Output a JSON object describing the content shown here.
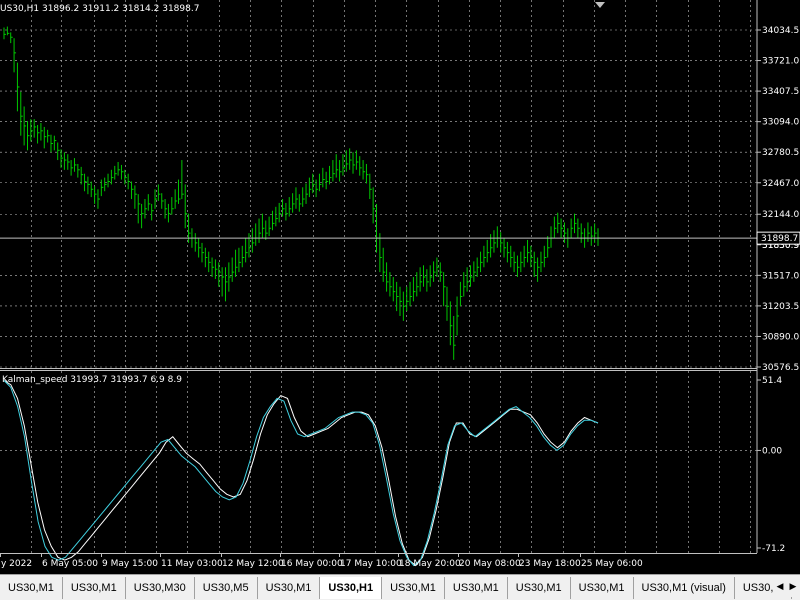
{
  "main_chart": {
    "symbol_label": "US30,H1",
    "ohlc_text": "31896.2 31911.2 31814.2 31898.7",
    "current_price_label": "31898.7",
    "hidden_price_label": "31830.9",
    "price_ticks": [
      "34034.5",
      "33721.0",
      "33407.5",
      "33094.0",
      "32780.5",
      "32467.0",
      "32144.0",
      "31830.5",
      "31517.0",
      "31203.5",
      "30890.0",
      "30576.5"
    ],
    "up_color": "#00c800",
    "grid_color": "#c0c0c0",
    "series_bars": [
      [
        33990,
        34060,
        33940
      ],
      [
        34000,
        34070,
        33980
      ],
      [
        33960,
        34010,
        33900
      ],
      [
        33800,
        33950,
        33600
      ],
      [
        33450,
        33700,
        33200
      ],
      [
        33150,
        33400,
        32950
      ],
      [
        33050,
        33250,
        32850
      ],
      [
        32950,
        33100,
        32800
      ],
      [
        33000,
        33120,
        32890
      ],
      [
        33040,
        33120,
        32930
      ],
      [
        32980,
        33060,
        32870
      ],
      [
        33000,
        33080,
        32900
      ],
      [
        32940,
        33040,
        32820
      ],
      [
        32950,
        33010,
        32880
      ],
      [
        32870,
        32960,
        32780
      ],
      [
        32900,
        32950,
        32800
      ],
      [
        32800,
        32880,
        32700
      ],
      [
        32720,
        32810,
        32620
      ],
      [
        32700,
        32780,
        32600
      ],
      [
        32680,
        32760,
        32600
      ],
      [
        32620,
        32700,
        32540
      ],
      [
        32650,
        32720,
        32580
      ],
      [
        32600,
        32660,
        32520
      ],
      [
        32550,
        32630,
        32450
      ],
      [
        32480,
        32560,
        32380
      ],
      [
        32450,
        32530,
        32350
      ],
      [
        32400,
        32480,
        32320
      ],
      [
        32350,
        32430,
        32250
      ],
      [
        32300,
        32400,
        32200
      ],
      [
        32420,
        32500,
        32330
      ],
      [
        32450,
        32520,
        32380
      ],
      [
        32480,
        32560,
        32420
      ],
      [
        32520,
        32600,
        32450
      ],
      [
        32560,
        32640,
        32500
      ],
      [
        32600,
        32680,
        32540
      ],
      [
        32580,
        32650,
        32500
      ],
      [
        32520,
        32600,
        32450
      ],
      [
        32480,
        32560,
        32400
      ],
      [
        32400,
        32480,
        32300
      ],
      [
        32350,
        32440,
        32200
      ],
      [
        32250,
        32350,
        32050
      ],
      [
        32150,
        32250,
        32000
      ],
      [
        32200,
        32300,
        32100
      ],
      [
        32250,
        32350,
        32180
      ],
      [
        32180,
        32250,
        32080
      ],
      [
        32300,
        32400,
        32200
      ],
      [
        32350,
        32450,
        32280
      ],
      [
        32280,
        32360,
        32200
      ],
      [
        32200,
        32300,
        32100
      ],
      [
        32150,
        32250,
        32060
      ],
      [
        32200,
        32320,
        32140
      ],
      [
        32280,
        32400,
        32200
      ],
      [
        32300,
        32500,
        32250
      ],
      [
        32350,
        32700,
        32300
      ],
      [
        32150,
        32450,
        32000
      ],
      [
        31950,
        32150,
        31850
      ],
      [
        31900,
        32000,
        31800
      ],
      [
        31850,
        31950,
        31760
      ],
      [
        31800,
        31900,
        31700
      ],
      [
        31750,
        31850,
        31650
      ],
      [
        31700,
        31800,
        31600
      ],
      [
        31650,
        31760,
        31550
      ],
      [
        31600,
        31700,
        31500
      ],
      [
        31580,
        31680,
        31480
      ],
      [
        31550,
        31650,
        31400
      ],
      [
        31500,
        31600,
        31300
      ],
      [
        31450,
        31600,
        31250
      ],
      [
        31500,
        31650,
        31350
      ],
      [
        31550,
        31700,
        31450
      ],
      [
        31600,
        31780,
        31500
      ],
      [
        31650,
        31800,
        31550
      ],
      [
        31700,
        31820,
        31600
      ],
      [
        31750,
        31900,
        31650
      ],
      [
        31800,
        31950,
        31700
      ],
      [
        31850,
        32000,
        31750
      ],
      [
        31900,
        32050,
        31820
      ],
      [
        31950,
        32100,
        31850
      ],
      [
        32000,
        32150,
        31900
      ],
      [
        31950,
        32080,
        31880
      ],
      [
        32000,
        32120,
        31920
      ],
      [
        32050,
        32180,
        31980
      ],
      [
        32100,
        32220,
        32020
      ],
      [
        32150,
        32260,
        32060
      ],
      [
        32200,
        32300,
        32120
      ],
      [
        32150,
        32260,
        32080
      ],
      [
        32200,
        32320,
        32120
      ],
      [
        32250,
        32360,
        32160
      ],
      [
        32300,
        32420,
        32200
      ],
      [
        32250,
        32350,
        32170
      ],
      [
        32300,
        32420,
        32220
      ],
      [
        32350,
        32460,
        32250
      ],
      [
        32400,
        32520,
        32320
      ],
      [
        32450,
        32560,
        32360
      ],
      [
        32400,
        32500,
        32320
      ],
      [
        32450,
        32560,
        32380
      ],
      [
        32500,
        32620,
        32420
      ],
      [
        32480,
        32580,
        32400
      ],
      [
        32520,
        32640,
        32450
      ],
      [
        32560,
        32700,
        32480
      ],
      [
        32600,
        32760,
        32520
      ],
      [
        32580,
        32700,
        32480
      ],
      [
        32620,
        32760,
        32540
      ],
      [
        32660,
        32800,
        32580
      ],
      [
        32700,
        32820,
        32600
      ],
      [
        32650,
        32780,
        32560
      ],
      [
        32680,
        32800,
        32600
      ],
      [
        32620,
        32740,
        32540
      ],
      [
        32580,
        32700,
        32500
      ],
      [
        32550,
        32660,
        32460
      ],
      [
        32400,
        32560,
        32300
      ],
      [
        32200,
        32420,
        32050
      ],
      [
        31900,
        32250,
        31750
      ],
      [
        31700,
        31950,
        31550
      ],
      [
        31550,
        31800,
        31450
      ],
      [
        31450,
        31650,
        31350
      ],
      [
        31400,
        31550,
        31300
      ],
      [
        31350,
        31500,
        31250
      ],
      [
        31300,
        31450,
        31150
      ],
      [
        31250,
        31400,
        31100
      ],
      [
        31200,
        31350,
        31050
      ],
      [
        31250,
        31400,
        31150
      ],
      [
        31300,
        31450,
        31200
      ],
      [
        31350,
        31500,
        31250
      ],
      [
        31400,
        31550,
        31300
      ],
      [
        31450,
        31600,
        31350
      ],
      [
        31500,
        31620,
        31400
      ],
      [
        31450,
        31580,
        31350
      ],
      [
        31500,
        31620,
        31400
      ],
      [
        31550,
        31660,
        31450
      ],
      [
        31600,
        31700,
        31500
      ],
      [
        31550,
        31650,
        31450
      ],
      [
        31400,
        31550,
        31200
      ],
      [
        31200,
        31400,
        31050
      ],
      [
        31000,
        31250,
        30800
      ],
      [
        30800,
        31100,
        30650
      ],
      [
        31100,
        31300,
        30900
      ],
      [
        31300,
        31450,
        31200
      ],
      [
        31400,
        31550,
        31300
      ],
      [
        31450,
        31600,
        31350
      ],
      [
        31500,
        31620,
        31400
      ],
      [
        31550,
        31660,
        31450
      ],
      [
        31600,
        31700,
        31500
      ],
      [
        31650,
        31760,
        31550
      ],
      [
        31700,
        31820,
        31600
      ],
      [
        31750,
        31880,
        31650
      ],
      [
        31800,
        31940,
        31700
      ],
      [
        31850,
        31980,
        31750
      ],
      [
        31900,
        32020,
        31800
      ],
      [
        31850,
        31960,
        31750
      ],
      [
        31800,
        31900,
        31700
      ],
      [
        31750,
        31860,
        31650
      ],
      [
        31700,
        31820,
        31600
      ],
      [
        31650,
        31760,
        31550
      ],
      [
        31600,
        31720,
        31500
      ],
      [
        31650,
        31760,
        31550
      ],
      [
        31700,
        31820,
        31600
      ],
      [
        31750,
        31880,
        31650
      ],
      [
        31700,
        31820,
        31600
      ],
      [
        31650,
        31760,
        31500
      ],
      [
        31600,
        31700,
        31450
      ],
      [
        31650,
        31760,
        31550
      ],
      [
        31700,
        31820,
        31600
      ],
      [
        31800,
        31920,
        31700
      ],
      [
        31900,
        32020,
        31800
      ],
      [
        32000,
        32120,
        31900
      ],
      [
        32050,
        32160,
        31950
      ],
      [
        32000,
        32100,
        31900
      ],
      [
        31950,
        32060,
        31850
      ],
      [
        31900,
        32000,
        31800
      ],
      [
        32000,
        32100,
        31900
      ],
      [
        32050,
        32150,
        31950
      ],
      [
        32000,
        32100,
        31900
      ],
      [
        31950,
        32050,
        31850
      ],
      [
        31900,
        32000,
        31800
      ],
      [
        31950,
        32060,
        31860
      ],
      [
        31920,
        32020,
        31820
      ],
      [
        31950,
        32050,
        31850
      ],
      [
        31900,
        32000,
        31820
      ]
    ]
  },
  "indicator": {
    "label": "Kalman_speed 31993.7 31993.7 6.9 8.9",
    "ticks": [
      "51.4",
      "0.00",
      "-71.2"
    ],
    "series": [
      {
        "color": "#ffffff",
        "values": [
          51,
          48,
          38,
          18,
          -10,
          -38,
          -58,
          -70,
          -78,
          -80,
          -78,
          -74,
          -68,
          -62,
          -56,
          -50,
          -44,
          -38,
          -32,
          -26,
          -20,
          -14,
          -8,
          -2,
          6,
          10,
          4,
          -2,
          -6,
          -10,
          -16,
          -22,
          -28,
          -32,
          -34,
          -32,
          -22,
          -6,
          12,
          26,
          34,
          40,
          38,
          24,
          14,
          10,
          12,
          14,
          16,
          20,
          24,
          26,
          28,
          28,
          26,
          18,
          2,
          -22,
          -48,
          -68,
          -80,
          -84,
          -78,
          -64,
          -44,
          -20,
          6,
          20,
          20,
          12,
          10,
          14,
          18,
          22,
          26,
          30,
          30,
          28,
          26,
          20,
          12,
          6,
          2,
          6,
          14,
          20,
          24,
          22,
          20
        ]
      },
      {
        "color": "#40d0e0",
        "values": [
          51,
          46,
          32,
          10,
          -22,
          -52,
          -70,
          -78,
          -80,
          -78,
          -72,
          -66,
          -60,
          -54,
          -48,
          -42,
          -36,
          -30,
          -24,
          -18,
          -12,
          -6,
          0,
          6,
          8,
          2,
          -4,
          -8,
          -12,
          -18,
          -24,
          -30,
          -34,
          -36,
          -34,
          -24,
          -8,
          10,
          24,
          32,
          38,
          36,
          22,
          12,
          10,
          12,
          14,
          16,
          20,
          24,
          26,
          28,
          28,
          26,
          20,
          4,
          -20,
          -46,
          -66,
          -78,
          -84,
          -80,
          -66,
          -46,
          -22,
          4,
          18,
          20,
          14,
          10,
          14,
          18,
          22,
          26,
          30,
          32,
          28,
          24,
          18,
          10,
          4,
          0,
          4,
          12,
          18,
          22,
          22,
          20
        ]
      }
    ]
  },
  "time_axis": {
    "labels": [
      "y 2022",
      "6 May 05:00",
      "9 May 15:00",
      "11 May 03:00",
      "12 May 12:00",
      "16 May 00:00",
      "17 May 10:00",
      "18 May 20:00",
      "20 May 08:00",
      "23 May 18:00",
      "25 May 06:00"
    ]
  },
  "tabs": [
    {
      "label": "US30,M1",
      "active": false
    },
    {
      "label": "US30,M1",
      "active": false
    },
    {
      "label": "US30,M30",
      "active": false
    },
    {
      "label": "US30,M5",
      "active": false
    },
    {
      "label": "US30,M1",
      "active": false
    },
    {
      "label": "US30,H1",
      "active": true
    },
    {
      "label": "US30,M1",
      "active": false
    },
    {
      "label": "US30,M1",
      "active": false
    },
    {
      "label": "US30,M1",
      "active": false
    },
    {
      "label": "US30,M1",
      "active": false
    },
    {
      "label": "US30,M1 (visual)",
      "active": false
    },
    {
      "label": "US30,M",
      "active": false
    }
  ],
  "scroll_glyphs": {
    "left": "◀",
    "right": "▶"
  }
}
